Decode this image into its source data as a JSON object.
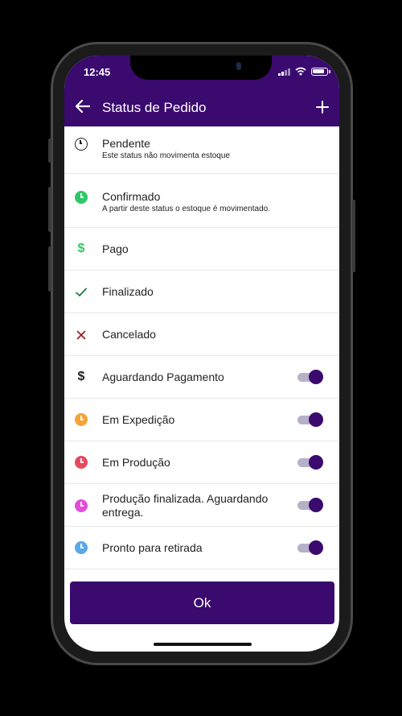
{
  "status_bar": {
    "time": "12:45"
  },
  "app_bar": {
    "title": "Status de Pedido",
    "back_icon": "arrow-left-icon",
    "add_icon": "plus-icon"
  },
  "statuses": [
    {
      "label": "Pendente",
      "sub": "Este status não movimenta estoque",
      "icon": "clock-outline-icon",
      "color": "#222222"
    },
    {
      "label": "Confirmado",
      "sub": "A partir deste status o estoque é movimentado.",
      "icon": "clock-filled-icon",
      "color": "#2ec866"
    },
    {
      "label": "Pago",
      "icon": "dollar-icon",
      "color": "#2ec866"
    },
    {
      "label": "Finalizado",
      "icon": "check-icon",
      "color": "#1f7a3f"
    },
    {
      "label": "Cancelado",
      "icon": "close-icon",
      "color": "#9b1c1c"
    },
    {
      "label": "Aguardando Pagamento",
      "icon": "dollar-icon",
      "color": "#222222",
      "enabled": true
    },
    {
      "label": "Em Expedição",
      "icon": "clock-filled-icon",
      "color": "#f2a33a",
      "enabled": true
    },
    {
      "label": "Em Produção",
      "icon": "clock-filled-icon",
      "color": "#e64a5f",
      "enabled": true
    },
    {
      "label": "Produção finalizada. Aguardando entrega.",
      "icon": "clock-filled-icon",
      "color": "#e04ed8",
      "enabled": true
    },
    {
      "label": "Pronto para retirada",
      "icon": "clock-filled-icon",
      "color": "#5aa8e6",
      "enabled": true
    }
  ],
  "ok_button": {
    "label": "Ok"
  },
  "colors": {
    "primary": "#3a0a6e",
    "toggle_track": "#b7b0c8"
  }
}
